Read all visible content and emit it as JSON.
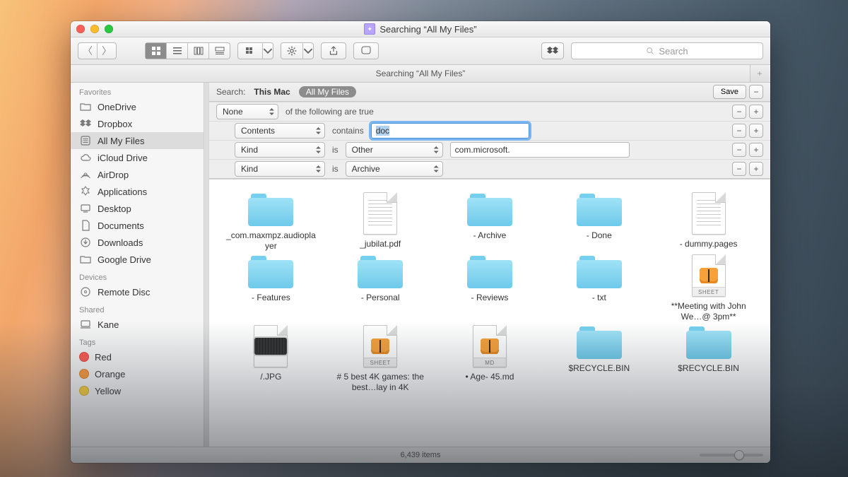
{
  "window": {
    "title": "Searching “All My Files”"
  },
  "tabbar": {
    "tab": "Searching “All My Files”"
  },
  "toolbar": {
    "search_placeholder": "Search"
  },
  "sidebar": {
    "sections": {
      "favorites": "Favorites",
      "devices": "Devices",
      "shared": "Shared",
      "tags": "Tags"
    },
    "favorites": [
      "OneDrive",
      "Dropbox",
      "All My Files",
      "iCloud Drive",
      "AirDrop",
      "Applications",
      "Desktop",
      "Documents",
      "Downloads",
      "Google Drive"
    ],
    "devices": [
      "Remote Disc"
    ],
    "shared": [
      "Kane"
    ],
    "tags": [
      {
        "label": "Red",
        "color": "#ff5a52"
      },
      {
        "label": "Orange",
        "color": "#ff9a3c"
      },
      {
        "label": "Yellow",
        "color": "#ffd23c"
      }
    ]
  },
  "search": {
    "label": "Search:",
    "scope_this_mac": "This Mac",
    "scope_all_my_files": "All My Files",
    "save": "Save"
  },
  "criteria": {
    "row0": {
      "match": "None",
      "text": "of the following are true"
    },
    "row1": {
      "attr": "Contents",
      "op": "contains",
      "value": "doc"
    },
    "row2": {
      "attr": "Kind",
      "op": "is",
      "kind": "Other",
      "value": "com.microsoft."
    },
    "row3": {
      "attr": "Kind",
      "op": "is",
      "kind": "Archive"
    }
  },
  "results": [
    {
      "type": "folder",
      "label": "_com.maxmpz.audioplayer"
    },
    {
      "type": "doc-lines",
      "label": "_jubilat.pdf"
    },
    {
      "type": "folder",
      "label": "- Archive"
    },
    {
      "type": "folder",
      "label": "- Done"
    },
    {
      "type": "doc-lines",
      "label": "- dummy.pages"
    },
    {
      "type": "folder",
      "label": "- Features"
    },
    {
      "type": "folder",
      "label": "- Personal"
    },
    {
      "type": "folder",
      "label": "- Reviews"
    },
    {
      "type": "folder",
      "label": "- txt"
    },
    {
      "type": "doc-butterfly",
      "band": "SHEET",
      "label": "**Meeting with John We…@ 3pm**"
    },
    {
      "type": "keyboard",
      "label": "/.JPG"
    },
    {
      "type": "doc-butterfly",
      "band": "SHEET",
      "label": "# 5 best 4K games: the best…lay in 4K"
    },
    {
      "type": "doc-butterfly",
      "band": "MD",
      "label": "• Age- 45.md"
    },
    {
      "type": "folder",
      "label": "$RECYCLE.BIN"
    },
    {
      "type": "folder",
      "label": "$RECYCLE.BIN"
    }
  ],
  "status": {
    "count": "6,439 items"
  }
}
